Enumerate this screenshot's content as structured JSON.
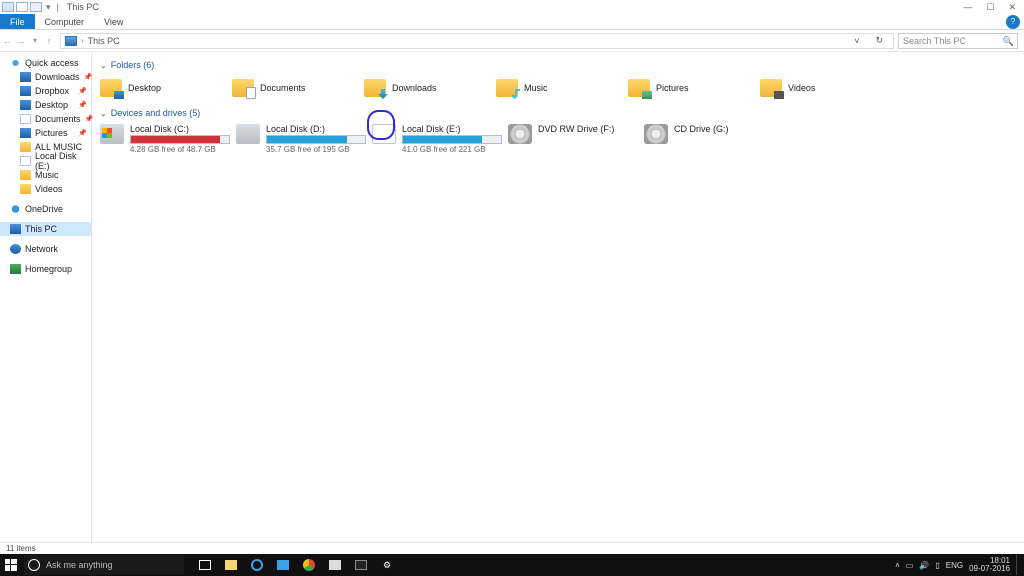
{
  "window": {
    "title": "This PC"
  },
  "ribbon": {
    "file": "File",
    "computer": "Computer",
    "view": "View"
  },
  "nav": {
    "location": "This PC",
    "search_placeholder": "Search This PC"
  },
  "sidebar": {
    "quick_access": "Quick access",
    "items": [
      {
        "label": "Downloads",
        "pinned": true
      },
      {
        "label": "Dropbox",
        "pinned": true
      },
      {
        "label": "Desktop",
        "pinned": true
      },
      {
        "label": "Documents",
        "pinned": true
      },
      {
        "label": "Pictures",
        "pinned": true
      },
      {
        "label": "ALL MUSIC",
        "pinned": false
      },
      {
        "label": "Local Disk (E:)",
        "pinned": false
      },
      {
        "label": "Music",
        "pinned": false
      },
      {
        "label": "Videos",
        "pinned": false
      }
    ],
    "onedrive": "OneDrive",
    "this_pc": "This PC",
    "network": "Network",
    "homegroup": "Homegroup"
  },
  "groups": {
    "folders_hdr": "Folders (6)",
    "drives_hdr": "Devices and drives (5)"
  },
  "folders": [
    {
      "label": "Desktop"
    },
    {
      "label": "Documents"
    },
    {
      "label": "Downloads"
    },
    {
      "label": "Music"
    },
    {
      "label": "Pictures"
    },
    {
      "label": "Videos"
    }
  ],
  "drives": [
    {
      "label": "Local Disk (C:)",
      "free": "4.28 GB free of 48.7 GB",
      "fill_pct": 91,
      "color": "red",
      "icon": "win"
    },
    {
      "label": "Local Disk (D:)",
      "free": "35.7 GB free of 195 GB",
      "fill_pct": 82,
      "color": "blue",
      "icon": "hdd"
    },
    {
      "label": "Local Disk (E:)",
      "free": "41.0 GB free of 221 GB",
      "fill_pct": 81,
      "color": "blue",
      "icon": "blank"
    },
    {
      "label": "DVD RW Drive (F:)",
      "free": "",
      "fill_pct": 0,
      "color": "",
      "icon": "dvd"
    },
    {
      "label": "CD Drive (G:)",
      "free": "",
      "fill_pct": 0,
      "color": "",
      "icon": "dvd"
    }
  ],
  "status": {
    "items": "11 items"
  },
  "taskbar": {
    "search_placeholder": "Ask me anything",
    "lang": "ENG",
    "time": "18:01",
    "date": "09-07-2016"
  }
}
